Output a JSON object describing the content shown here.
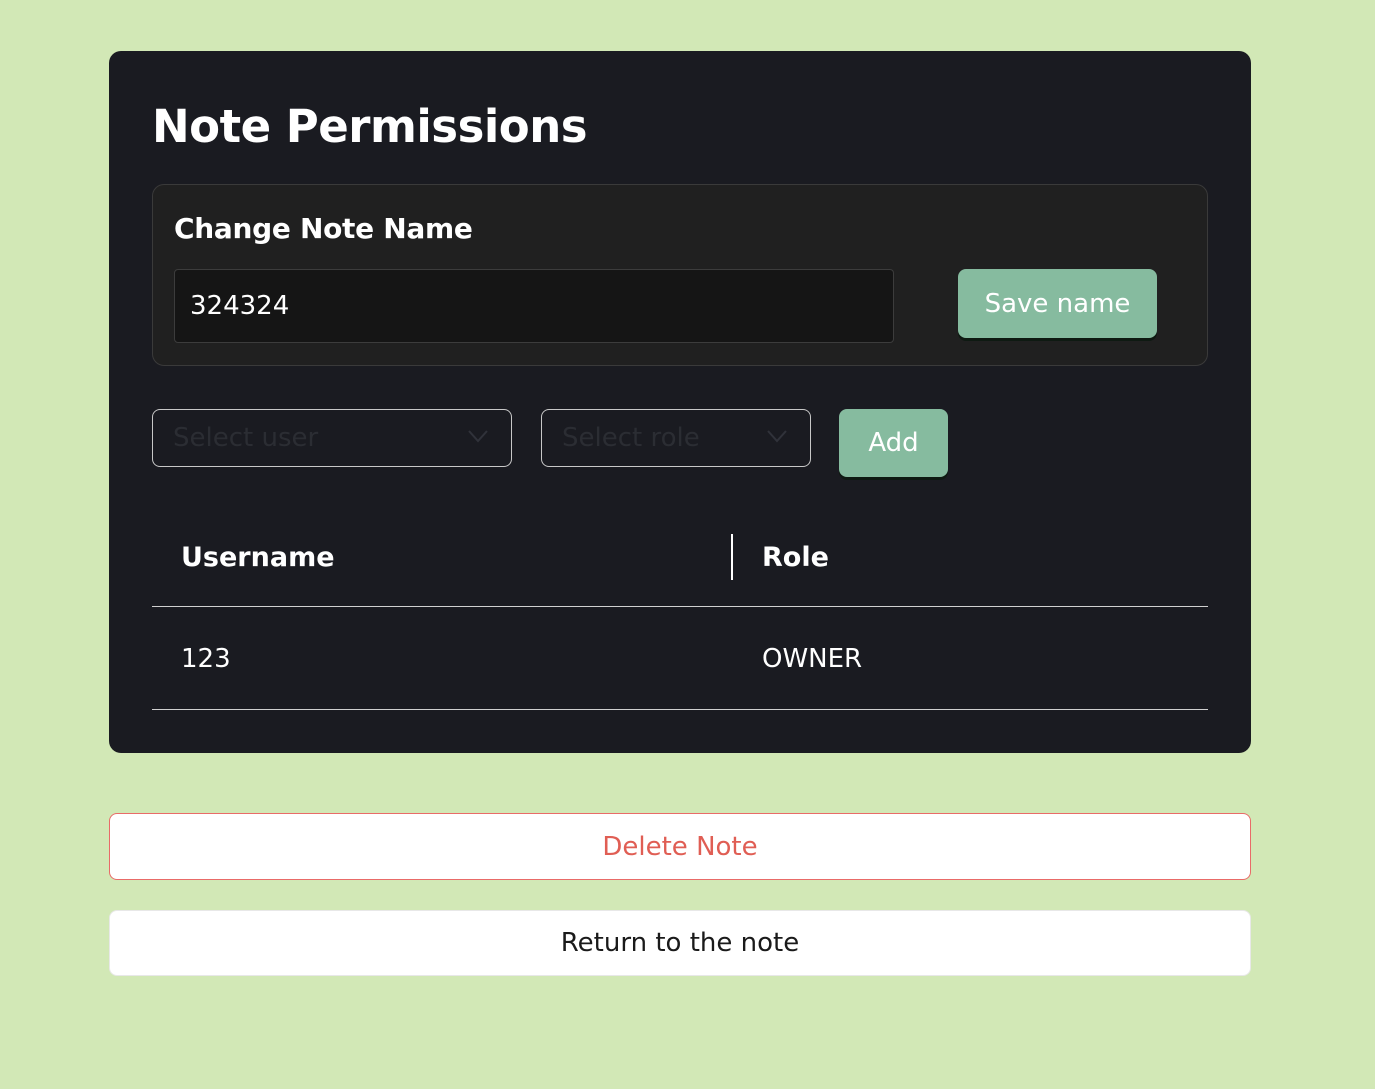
{
  "page": {
    "title": "Note Permissions"
  },
  "rename": {
    "title": "Change Note Name",
    "name_value": "324324",
    "save_label": "Save name"
  },
  "add_permission": {
    "user_placeholder": "Select user",
    "role_placeholder": "Select role",
    "add_label": "Add"
  },
  "permissions_table": {
    "columns": [
      "Username",
      "Role"
    ],
    "rows": [
      {
        "username": "123",
        "role": "OWNER"
      }
    ]
  },
  "actions": {
    "delete_label": "Delete Note",
    "return_label": "Return to the note"
  },
  "colors": {
    "background": "#d2e8b6",
    "card": "#1a1b21",
    "accent_green": "#86bb9f",
    "danger": "#e05e54"
  },
  "icons": {
    "select_chevron": "chevron-down-icon"
  }
}
